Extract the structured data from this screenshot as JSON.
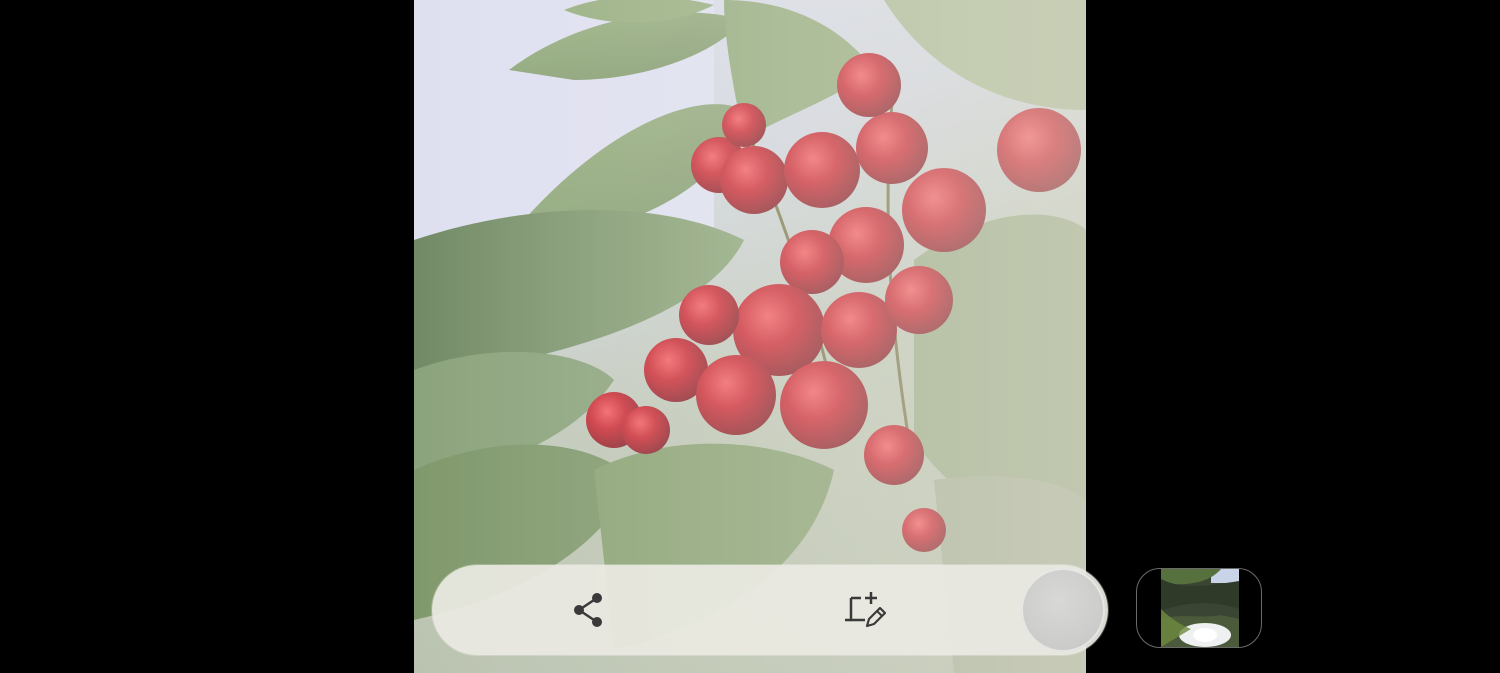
{
  "screen": {
    "app": "Camera preview"
  },
  "photo": {
    "description_tag": "cherries-on-branch-photo"
  },
  "actions": {
    "share_icon": "share-icon",
    "edit_icon": "crop-edit-icon",
    "shutter": "shutter-button"
  },
  "gallery": {
    "thumbnail_icon": "gallery-thumbnail"
  },
  "colors": {
    "background": "#000000",
    "pill": "#ebeae2",
    "icon": "#3a3a3a",
    "cherry": "#c4141f",
    "leaf": "#7f9a63"
  }
}
